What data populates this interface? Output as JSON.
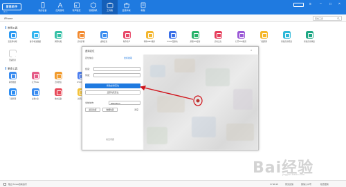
{
  "app": {
    "logo_text": "爱思助手",
    "logo_sub": "i4.cn",
    "accent": "#1f7ae0"
  },
  "nav": [
    {
      "label": "我的设备",
      "icon": "phone-icon"
    },
    {
      "label": "应用游戏",
      "icon": "apps-icon"
    },
    {
      "label": "铃声壁纸",
      "icon": "music-icon"
    },
    {
      "label": "智能刷机",
      "icon": "box-icon"
    },
    {
      "label": "工具箱",
      "icon": "toolbox-icon",
      "active": true
    },
    {
      "label": "爱思商城",
      "icon": "store-icon"
    },
    {
      "label": "教程",
      "icon": "book-icon"
    }
  ],
  "subbar": {
    "device": "iPhone",
    "search_placeholder": "查找工具"
  },
  "sections": {
    "common": "常用工具",
    "more": "更多工具"
  },
  "tools_row1": [
    {
      "label": "安装移动端",
      "color": "#2b9af3"
    },
    {
      "label": "备份/恢复数据",
      "color": "#34b6f0"
    },
    {
      "label": "清理垃圾",
      "color": "#35c0a6"
    },
    {
      "label": "实时屏幕",
      "color": "#f28a30"
    },
    {
      "label": "虚拟定位",
      "color": "#3c8ef0"
    },
    {
      "label": "制作铃声",
      "color": "#e84a6a"
    },
    {
      "label": "转换HEIC图片",
      "color": "#f3b62e"
    },
    {
      "label": "iTunes及驱动",
      "color": "#3a6fe8"
    },
    {
      "label": "屏蔽iOS更新",
      "color": "#27b36a"
    },
    {
      "label": "实时日志",
      "color": "#e63e5c"
    },
    {
      "label": "打开SSH通道",
      "color": "#9b59d6"
    },
    {
      "label": "下载固件",
      "color": "#f5b729"
    },
    {
      "label": "修复应用闪退",
      "color": "#2fb8d8"
    },
    {
      "label": "修复应用弹窗",
      "color": "#1ea784"
    }
  ],
  "tools_row1b": [
    {
      "label": "压缩照片",
      "color": "#ffffff"
    }
  ],
  "tools_row2": [
    {
      "label": "转移数据",
      "color": "#3a8cf0"
    },
    {
      "label": "打开SSH",
      "color": "#e55b87"
    },
    {
      "label": "迁移微信",
      "color": "#f29b2c"
    },
    {
      "label": "IPCC固件",
      "color": "#4d7ff0"
    },
    {
      "label": "照片转移",
      "color": "#f2a34a"
    },
    {
      "label": "手机投屏直播",
      "color": "#c94ad6"
    },
    {
      "label": "电池信息",
      "color": "#25b46e"
    },
    {
      "label": "反激活设备",
      "color": "#3a8cf0"
    },
    {
      "label": "清除证书",
      "color": "#43c1d8"
    }
  ],
  "tools_row3": [
    {
      "label": "下载管理",
      "color": "#2f8ef2"
    },
    {
      "label": "虚拟U盘",
      "color": "#3a8cf0"
    },
    {
      "label": "重启设备",
      "color": "#e74a5a"
    },
    {
      "label": "关闭设备",
      "color": "#f5c33a"
    }
  ],
  "dialog": {
    "title": "虚拟定位",
    "left_title": "定位信息",
    "left_title_right": "坐标拾取",
    "lng_label": "经度：",
    "lat_label": "纬度：",
    "modify_btn": "修改虚拟定位",
    "restore_btn": "还原真实定位",
    "city_label": "当前城市：",
    "city_value": "Shenzhen",
    "recent_label": "最近位置",
    "favorite_label": "收藏位置",
    "clear_label": "清空",
    "help": "常见问题"
  },
  "statusbar": {
    "checkbox_label": "阻止iTunes自动运行",
    "version": "V7.98.15",
    "feedback": "意见反馈",
    "wechat": "微信公众号",
    "update": "检查更新"
  },
  "watermark": {
    "text": "Bai经验",
    "sub": "jingyan.baidu.com"
  }
}
